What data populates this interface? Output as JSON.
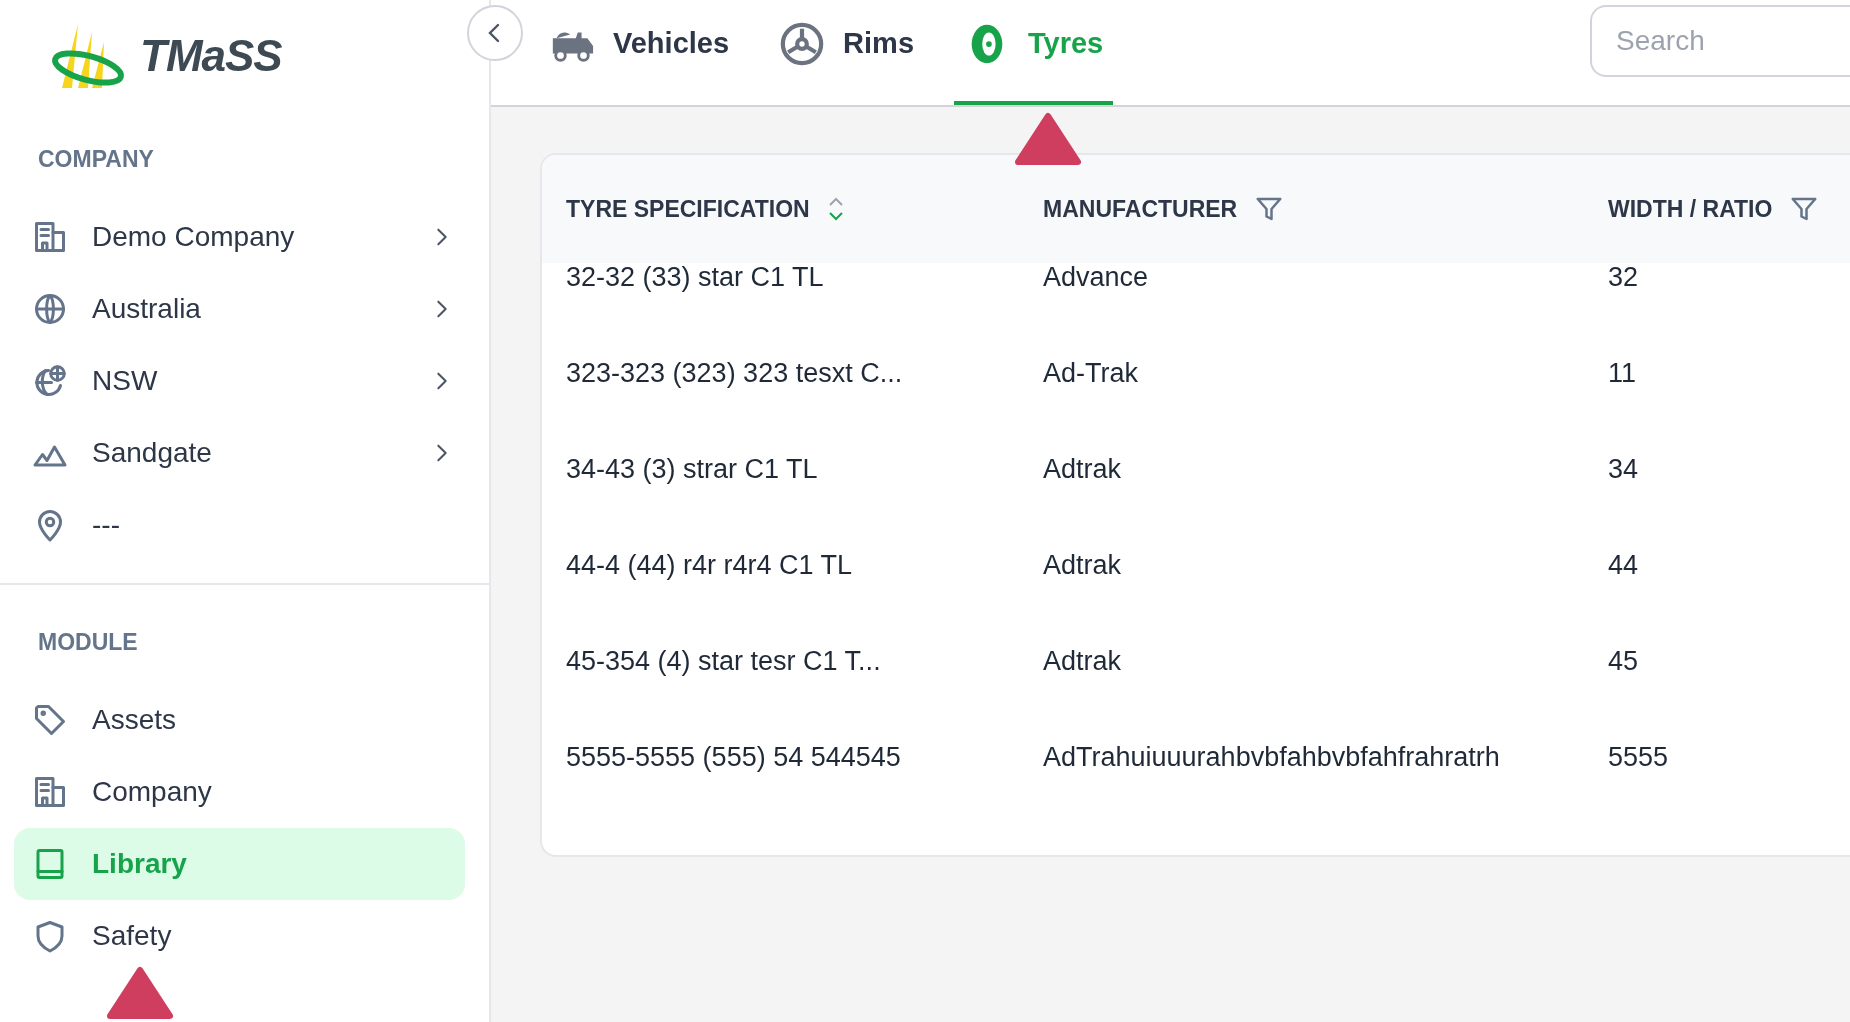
{
  "logo": {
    "text": "TMaSS"
  },
  "sidebar": {
    "sections": [
      {
        "title": "COMPANY",
        "items": [
          {
            "kind": "building",
            "label": "Demo Company",
            "expandable": true,
            "selected": false
          },
          {
            "kind": "globe",
            "label": "Australia",
            "expandable": true,
            "selected": false
          },
          {
            "kind": "region",
            "label": "NSW",
            "expandable": true,
            "selected": false
          },
          {
            "kind": "mountain",
            "label": "Sandgate",
            "expandable": true,
            "selected": false
          },
          {
            "kind": "pin",
            "label": "---",
            "expandable": false,
            "selected": false
          }
        ]
      },
      {
        "title": "MODULE",
        "items": [
          {
            "kind": "tag",
            "label": "Assets",
            "expandable": false,
            "selected": false
          },
          {
            "kind": "building",
            "label": "Company",
            "expandable": false,
            "selected": false
          },
          {
            "kind": "book",
            "label": "Library",
            "expandable": false,
            "selected": true
          },
          {
            "kind": "shield",
            "label": "Safety",
            "expandable": false,
            "selected": false
          }
        ]
      }
    ]
  },
  "tabs": [
    {
      "kind": "truck",
      "label": "Vehicles",
      "selected": false
    },
    {
      "kind": "rim",
      "label": "Rims",
      "selected": false
    },
    {
      "kind": "tyre",
      "label": "Tyres",
      "selected": true
    }
  ],
  "search": {
    "placeholder": "Search"
  },
  "table": {
    "columns": [
      {
        "label": "TYRE SPECIFICATION",
        "kind": "sort"
      },
      {
        "label": "MANUFACTURER",
        "kind": "filter"
      },
      {
        "label": "WIDTH / RATIO",
        "kind": "filter"
      }
    ],
    "rows": [
      [
        "32-32 (33) star C1 TL",
        "Advance",
        "32"
      ],
      [
        "323-323 (323) 323 tesxt C...",
        "Ad-Trak",
        "11"
      ],
      [
        "34-43 (3) strar C1 TL",
        "Adtrak",
        "34"
      ],
      [
        "44-4 (44) r4r r4r4 C1 TL",
        "Adtrak",
        "44"
      ],
      [
        "45-354 (4) star tesr C1 T...",
        "Adtrak",
        "45"
      ],
      [
        "5555-5555 (555) 54 544545",
        "AdTrahuiuuurahbvbfahbvbfahfrahratrh",
        "5555"
      ]
    ]
  }
}
